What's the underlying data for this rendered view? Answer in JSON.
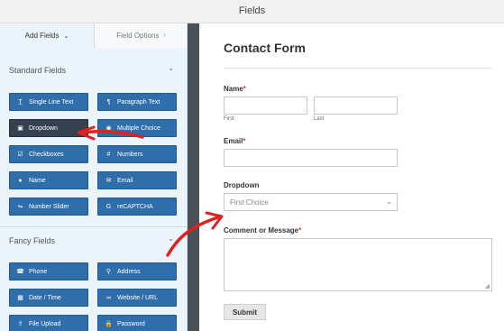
{
  "window": {
    "title": "Fields"
  },
  "tabs": {
    "add_fields": "Add Fields",
    "add_fields_chev": "⌄",
    "field_options": "Field Options",
    "field_options_chev": "›"
  },
  "standard": {
    "title": "Standard Fields",
    "chev": "⌄",
    "items": [
      {
        "label": "Single Line Text",
        "icon": "T̲"
      },
      {
        "label": "Paragraph Text",
        "icon": "¶"
      },
      {
        "label": "Dropdown",
        "icon": "▣"
      },
      {
        "label": "Multiple Choice",
        "icon": "◉"
      },
      {
        "label": "Checkboxes",
        "icon": "☑"
      },
      {
        "label": "Numbers",
        "icon": "#"
      },
      {
        "label": "Name",
        "icon": "●"
      },
      {
        "label": "Email",
        "icon": "✉"
      },
      {
        "label": "Number Slider",
        "icon": "⇋"
      },
      {
        "label": "reCAPTCHA",
        "icon": "G"
      }
    ]
  },
  "fancy": {
    "title": "Fancy Fields",
    "chev": "⌄",
    "items": [
      {
        "label": "Phone",
        "icon": "☎"
      },
      {
        "label": "Address",
        "icon": "⚲"
      },
      {
        "label": "Date / Time",
        "icon": "▦"
      },
      {
        "label": "Website / URL",
        "icon": "∞"
      },
      {
        "label": "File Upload",
        "icon": "⇪"
      },
      {
        "label": "Password",
        "icon": "🔒"
      }
    ]
  },
  "form": {
    "title": "Contact Form",
    "name_label": "Name",
    "name_req": "*",
    "first_sublabel": "First",
    "last_sublabel": "Last",
    "email_label": "Email",
    "email_req": "*",
    "dropdown_label": "Dropdown",
    "dropdown_value": "First Choice",
    "dropdown_chev": "⌄",
    "message_label": "Comment or Message",
    "message_req": "*",
    "submit_label": "Submit"
  },
  "colors": {
    "button_blue": "#2f6eab",
    "button_dark": "#36414f",
    "panel_bg": "#ebf3fb",
    "arrow_red": "#e0211d"
  }
}
